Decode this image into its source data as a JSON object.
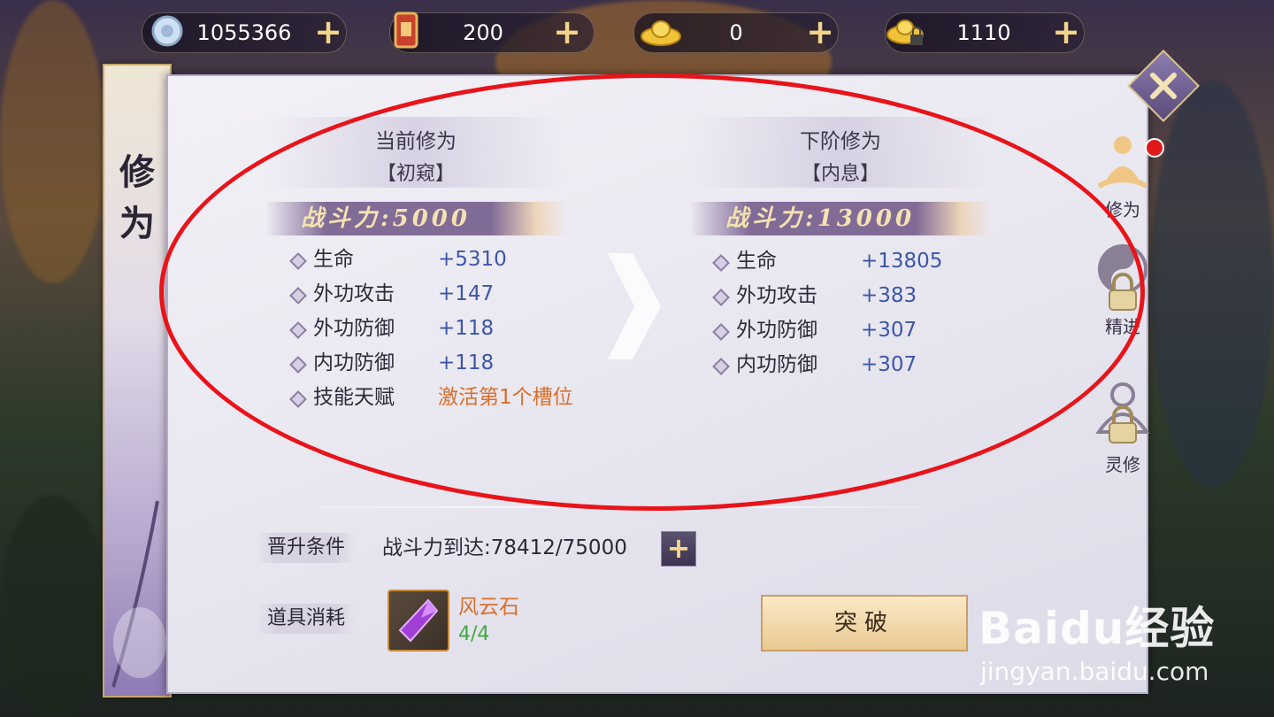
{
  "currencies": [
    {
      "icon": "silver-coin-icon",
      "value": "1055366"
    },
    {
      "icon": "token-icon",
      "value": "200"
    },
    {
      "icon": "gold-ingot-icon",
      "value": "0"
    },
    {
      "icon": "locked-ingot-icon",
      "value": "1110"
    }
  ],
  "banner": {
    "chars": [
      "修",
      "为"
    ]
  },
  "current": {
    "title": "当前修为",
    "stage": "【初窥】",
    "power": "战斗力:5000",
    "stats": [
      {
        "label": "生命",
        "value": "+5310"
      },
      {
        "label": "外功攻击",
        "value": "+147"
      },
      {
        "label": "外功防御",
        "value": "+118"
      },
      {
        "label": "内功防御",
        "value": "+118"
      },
      {
        "label": "技能天赋",
        "value": "激活第1个槽位"
      }
    ]
  },
  "next": {
    "title": "下阶修为",
    "stage": "【内息】",
    "power": "战斗力:13000",
    "stats": [
      {
        "label": "生命",
        "value": "+13805"
      },
      {
        "label": "外功攻击",
        "value": "+383"
      },
      {
        "label": "外功防御",
        "value": "+307"
      },
      {
        "label": "内功防御",
        "value": "+307"
      }
    ]
  },
  "condition": {
    "tag": "晋升条件",
    "text": "战斗力到达:78412/75000"
  },
  "consume": {
    "tag": "道具消耗",
    "item_name": "风云石",
    "item_count": "4/4"
  },
  "breakthrough_label": "突破",
  "side_tabs": [
    {
      "label": "修为",
      "icon": "meditation-icon",
      "locked": false
    },
    {
      "label": "精进",
      "icon": "yin-yang-icon",
      "locked": true
    },
    {
      "label": "灵修",
      "icon": "spirit-icon",
      "locked": true
    }
  ],
  "watermark": {
    "brand": "Baidu经验",
    "url": "jingyan.baidu.com"
  },
  "colors": {
    "stat_blue": "#3d56a8",
    "highlight_orange": "#d9702a",
    "count_green": "#3faa3f",
    "annotation_red": "#e8141a"
  }
}
